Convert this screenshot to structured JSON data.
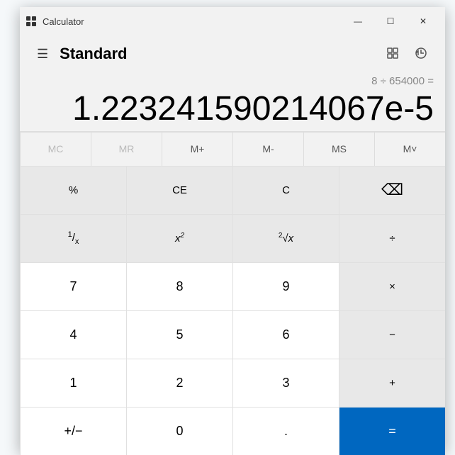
{
  "window": {
    "title": "Calculator",
    "minimize_label": "—",
    "maximize_label": "☐",
    "close_label": "✕"
  },
  "header": {
    "title": "Standard",
    "hamburger_label": "☰"
  },
  "display": {
    "expression": "8 ÷ 654000 =",
    "main_value": "1.223241590214067e-5"
  },
  "memory_buttons": [
    {
      "label": "MC",
      "id": "mc",
      "disabled": true
    },
    {
      "label": "MR",
      "id": "mr",
      "disabled": true
    },
    {
      "label": "M+",
      "id": "mplus",
      "disabled": false
    },
    {
      "label": "M-",
      "id": "mminus",
      "disabled": false
    },
    {
      "label": "MS",
      "id": "ms",
      "disabled": false
    },
    {
      "label": "M˅",
      "id": "mrecall",
      "disabled": false
    }
  ],
  "buttons": [
    {
      "label": "%",
      "id": "percent",
      "type": "scientific"
    },
    {
      "label": "CE",
      "id": "ce",
      "type": "scientific"
    },
    {
      "label": "C",
      "id": "clear",
      "type": "scientific"
    },
    {
      "label": "⌫",
      "id": "backspace",
      "type": "scientific"
    },
    {
      "label": "1/x",
      "id": "reciprocal",
      "type": "scientific"
    },
    {
      "label": "x²",
      "id": "square",
      "type": "scientific"
    },
    {
      "label": "²√x",
      "id": "sqrt",
      "type": "scientific"
    },
    {
      "label": "÷",
      "id": "divide",
      "type": "operator"
    },
    {
      "label": "7",
      "id": "seven",
      "type": "number"
    },
    {
      "label": "8",
      "id": "eight",
      "type": "number"
    },
    {
      "label": "9",
      "id": "nine",
      "type": "number"
    },
    {
      "label": "×",
      "id": "multiply",
      "type": "operator"
    },
    {
      "label": "4",
      "id": "four",
      "type": "number"
    },
    {
      "label": "5",
      "id": "five",
      "type": "number"
    },
    {
      "label": "6",
      "id": "six",
      "type": "number"
    },
    {
      "label": "−",
      "id": "subtract",
      "type": "operator"
    },
    {
      "label": "1",
      "id": "one",
      "type": "number"
    },
    {
      "label": "2",
      "id": "two",
      "type": "number"
    },
    {
      "label": "3",
      "id": "three",
      "type": "number"
    },
    {
      "label": "+",
      "id": "add",
      "type": "operator"
    },
    {
      "label": "+/−",
      "id": "negate",
      "type": "number"
    },
    {
      "label": "0",
      "id": "zero",
      "type": "number"
    },
    {
      "label": ".",
      "id": "decimal",
      "type": "number"
    },
    {
      "label": "=",
      "id": "equals",
      "type": "equals"
    }
  ]
}
